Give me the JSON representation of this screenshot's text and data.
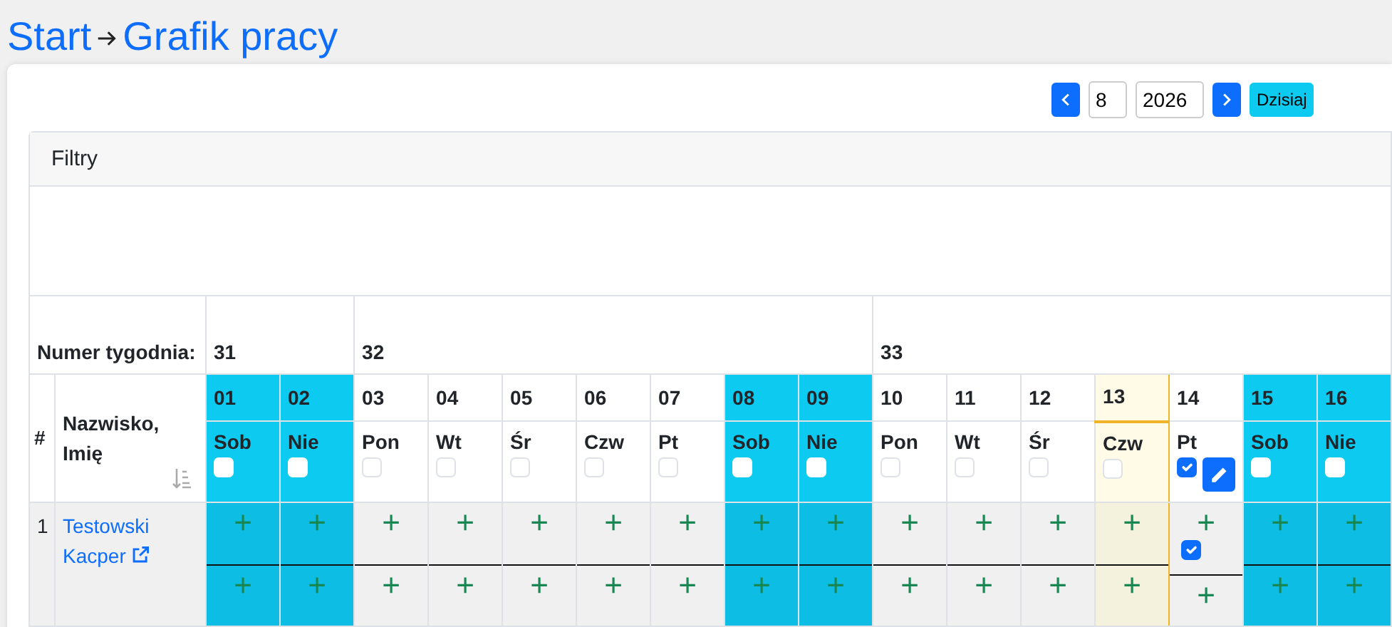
{
  "breadcrumb": [
    {
      "label": "Start"
    },
    {
      "label": "Grafik pracy"
    }
  ],
  "month": "8",
  "year": "2026",
  "today_button": "Dzisiaj",
  "filters": {
    "title": "Filtry"
  },
  "table": {
    "week_label": "Numer tygodnia:",
    "index_header": "#",
    "name_header": "Nazwisko, Imię",
    "weeks": [
      {
        "label": "31",
        "days": [
          {
            "number": "01",
            "name": "Sob",
            "kind": "weekend",
            "today": false,
            "checked": false
          },
          {
            "number": "02",
            "name": "Nie",
            "kind": "weekend",
            "today": false,
            "checked": false
          }
        ]
      },
      {
        "label": "32",
        "days": [
          {
            "number": "03",
            "name": "Pon",
            "kind": "workday",
            "today": false,
            "checked": false
          },
          {
            "number": "04",
            "name": "Wt",
            "kind": "workday",
            "today": false,
            "checked": false
          },
          {
            "number": "05",
            "name": "Śr",
            "kind": "workday",
            "today": false,
            "checked": false
          },
          {
            "number": "06",
            "name": "Czw",
            "kind": "workday",
            "today": false,
            "checked": false
          },
          {
            "number": "07",
            "name": "Pt",
            "kind": "workday",
            "today": false,
            "checked": false
          },
          {
            "number": "08",
            "name": "Sob",
            "kind": "weekend",
            "today": false,
            "checked": false
          },
          {
            "number": "09",
            "name": "Nie",
            "kind": "weekend",
            "today": false,
            "checked": false
          }
        ]
      },
      {
        "label": "33",
        "days": [
          {
            "number": "10",
            "name": "Pon",
            "kind": "workday",
            "today": false,
            "checked": false
          },
          {
            "number": "11",
            "name": "Wt",
            "kind": "workday",
            "today": false,
            "checked": false
          },
          {
            "number": "12",
            "name": "Śr",
            "kind": "workday",
            "today": false,
            "checked": false
          },
          {
            "number": "13",
            "name": "Czw",
            "kind": "workday",
            "today": true,
            "checked": false
          },
          {
            "number": "14",
            "name": "Pt",
            "kind": "workday",
            "today": false,
            "checked": true
          },
          {
            "number": "15",
            "name": "Sob",
            "kind": "weekend",
            "today": false,
            "checked": false
          },
          {
            "number": "16",
            "name": "Nie",
            "kind": "weekend",
            "today": false,
            "checked": false
          }
        ]
      }
    ],
    "rows": [
      {
        "index": "1",
        "name": "Testowski Kacper",
        "days": [
          {
            "slots": [
              "+",
              "+"
            ],
            "checked": false
          },
          {
            "slots": [
              "+",
              "+"
            ],
            "checked": false
          },
          {
            "slots": [
              "+",
              "+"
            ],
            "checked": false
          },
          {
            "slots": [
              "+",
              "+"
            ],
            "checked": false
          },
          {
            "slots": [
              "+",
              "+"
            ],
            "checked": false
          },
          {
            "slots": [
              "+",
              "+"
            ],
            "checked": false
          },
          {
            "slots": [
              "+",
              "+"
            ],
            "checked": false
          },
          {
            "slots": [
              "+",
              "+"
            ],
            "checked": false
          },
          {
            "slots": [
              "+",
              "+"
            ],
            "checked": false
          },
          {
            "slots": [
              "+",
              "+"
            ],
            "checked": false
          },
          {
            "slots": [
              "+",
              "+"
            ],
            "checked": false
          },
          {
            "slots": [
              "+",
              "+"
            ],
            "checked": false
          },
          {
            "slots": [
              "+",
              "+"
            ],
            "checked": false
          },
          {
            "slots": [
              "+",
              "+"
            ],
            "checked": true
          },
          {
            "slots": [
              "+",
              "+"
            ],
            "checked": false
          },
          {
            "slots": [
              "+",
              "+"
            ],
            "checked": false
          }
        ]
      }
    ]
  }
}
